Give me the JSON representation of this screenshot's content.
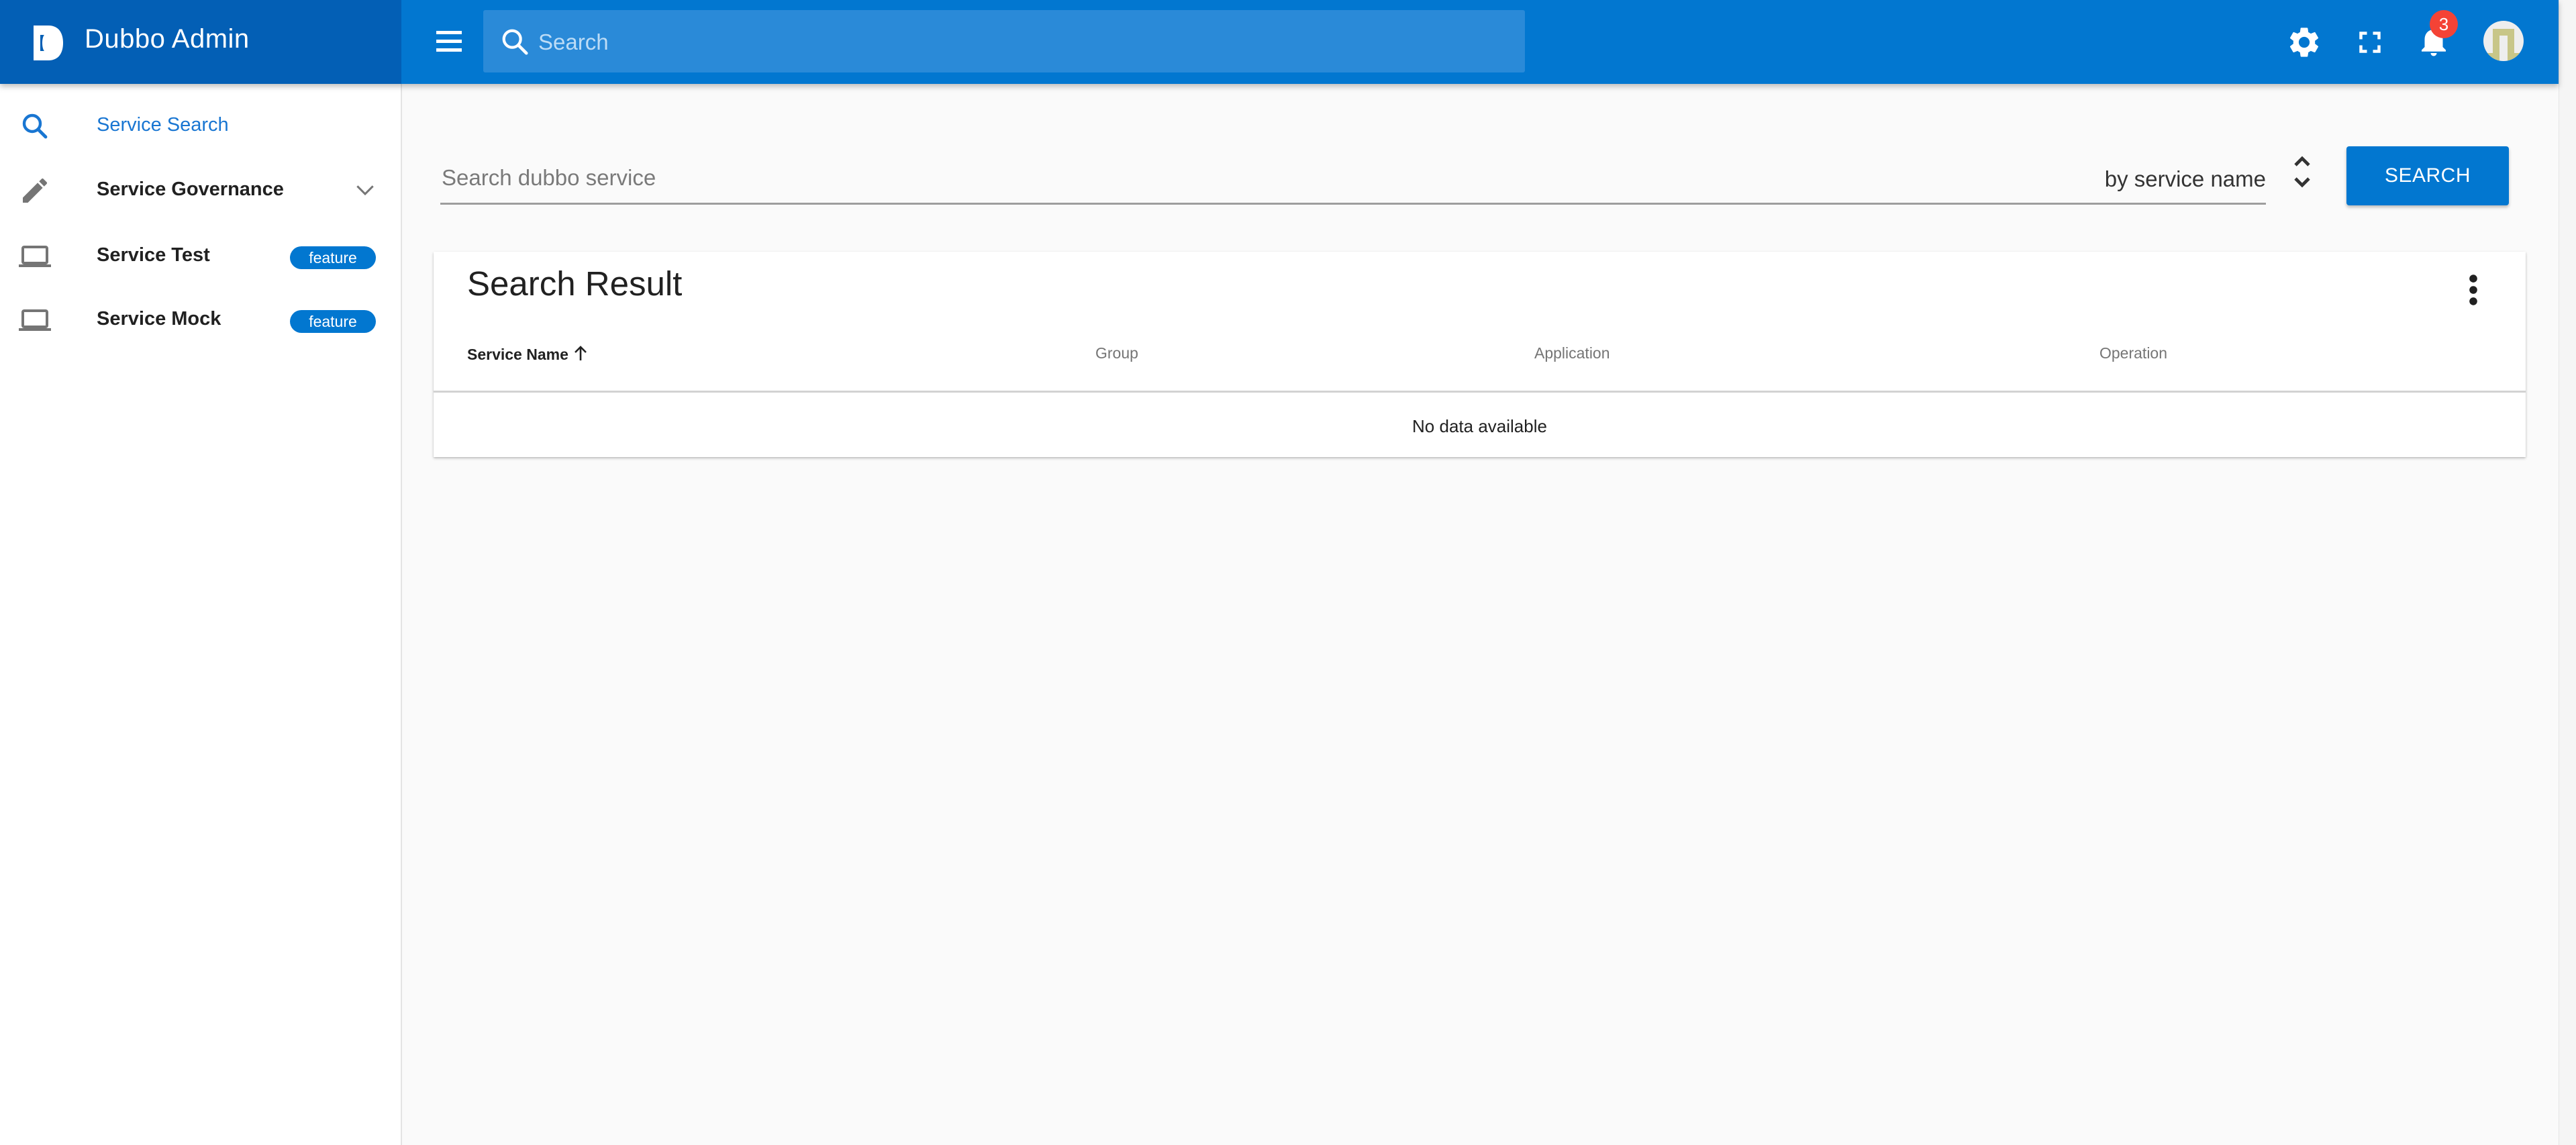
{
  "header": {
    "app_title": "Dubbo Admin",
    "search_placeholder": "Search",
    "notification_count": "3",
    "colors": {
      "primary": "#0277d0",
      "brand_bg": "#035fb5",
      "badge": "#f44336"
    }
  },
  "sidebar": {
    "items": [
      {
        "label": "Service Search",
        "icon": "search-icon",
        "active": true
      },
      {
        "label": "Service Governance",
        "icon": "pencil-icon",
        "expandable": true
      },
      {
        "label": "Service Test",
        "icon": "laptop-icon",
        "badge": "feature"
      },
      {
        "label": "Service Mock",
        "icon": "laptop-icon",
        "badge": "feature"
      }
    ]
  },
  "main": {
    "search_placeholder": "Search dubbo service",
    "search_value": "",
    "search_by": "by service name",
    "search_button": "SEARCH"
  },
  "results": {
    "title": "Search Result",
    "columns": [
      {
        "label": "Service Name",
        "sorted": "asc"
      },
      {
        "label": "Group"
      },
      {
        "label": "Application"
      },
      {
        "label": "Operation"
      }
    ],
    "empty_text": "No data available"
  }
}
